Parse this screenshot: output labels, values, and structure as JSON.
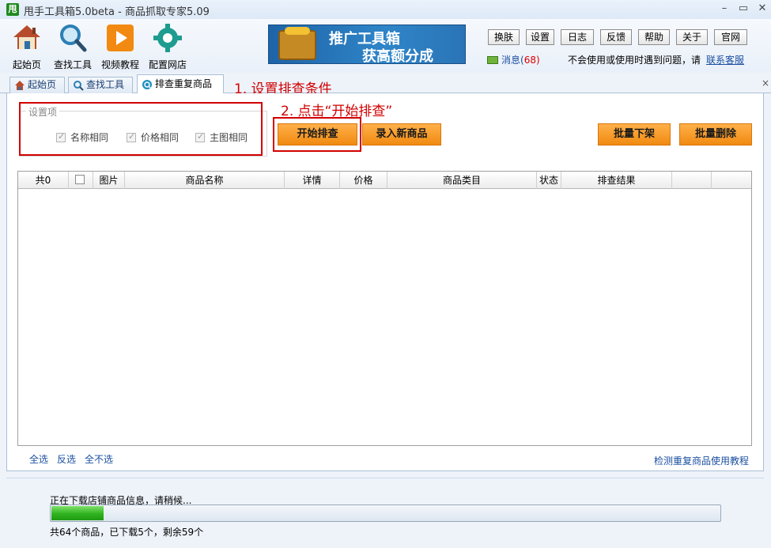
{
  "window": {
    "logo_char": "甩",
    "title": "甩手工具箱5.0beta - 商品抓取专家5.09",
    "minimize": "–",
    "maximize": "▭",
    "close": "✕"
  },
  "toolbar": {
    "items": [
      {
        "label": "起始页",
        "icon": "home-icon"
      },
      {
        "label": "查找工具",
        "icon": "magnifier-icon"
      },
      {
        "label": "视频教程",
        "icon": "play-icon"
      },
      {
        "label": "配置网店",
        "icon": "gear-icon"
      }
    ],
    "banner": {
      "line1": "推广工具箱",
      "line2": "获高额分成"
    },
    "small_buttons": [
      "换肤",
      "设置",
      "日志",
      "反馈",
      "帮助",
      "关于",
      "官网"
    ],
    "messages": {
      "label": "消息(",
      "count": "68",
      "close": ")"
    },
    "help_text": "不会使用或使用时遇到问题，请",
    "help_link": "联系客服"
  },
  "tabs": [
    {
      "label": "起始页",
      "icon": "home-icon"
    },
    {
      "label": "查找工具",
      "icon": "magnifier-icon"
    },
    {
      "label": "排查重复商品",
      "icon": "duplicate-check-icon",
      "active": true
    }
  ],
  "tab_close": "×",
  "annotations": {
    "step1": "1. 设置排查条件",
    "step2": "2. 点击“开始排查”"
  },
  "settings": {
    "legend": "设置项",
    "options": [
      {
        "label": "名称相同",
        "checked": true,
        "disabled": true
      },
      {
        "label": "价格相同",
        "checked": true,
        "disabled": true
      },
      {
        "label": "主图相同",
        "checked": true,
        "disabled": true
      }
    ]
  },
  "actions": {
    "start": "开始排查",
    "import": "录入新商品",
    "batch_unlist": "批量下架",
    "batch_delete": "批量删除"
  },
  "table": {
    "columns": [
      "共0",
      "",
      "图片",
      "商品名称",
      "详情",
      "价格",
      "商品类目",
      "状态",
      "排查结果",
      "",
      ""
    ],
    "rows": []
  },
  "selection": {
    "all": "全选",
    "invert": "反选",
    "none": "全不选"
  },
  "tutorial_link": "检测重复商品使用教程",
  "status": {
    "line1": "正在下载店铺商品信息，请稍候...",
    "line2": "共64个商品，已下载5个，剩余59个",
    "progress": 0.078,
    "bar_color": "#2fb31f"
  },
  "colors": {
    "accent_orange": "#f08a10",
    "annotation_red": "#d20000",
    "link_blue": "#1a4fa0"
  }
}
